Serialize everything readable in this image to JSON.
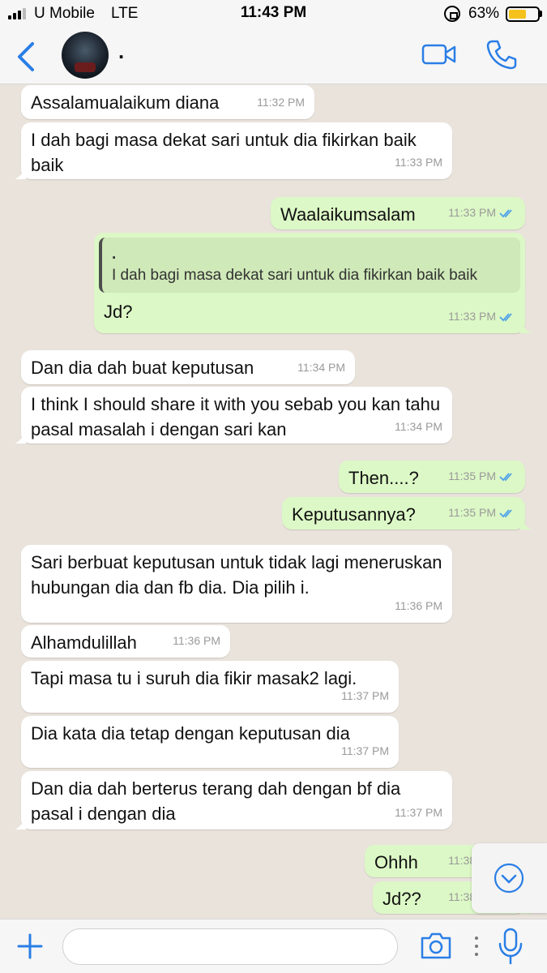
{
  "status_bar": {
    "carrier": "U Mobile",
    "network": "LTE",
    "time": "11:43 PM",
    "battery_percent": "63%",
    "battery_level": 0.63,
    "signal_bars": 3,
    "battery_color": "#f4c21b"
  },
  "header": {
    "contact_name": ".",
    "back_icon": "chevron-left-icon",
    "video_icon": "video-camera-icon",
    "call_icon": "phone-icon",
    "accent_color": "#2a7ee6"
  },
  "messages": [
    {
      "dir": "in",
      "text": "Assalamualaikum diana",
      "time": "11:32 PM"
    },
    {
      "dir": "in",
      "text": "I dah bagi masa dekat sari untuk dia fikirkan baik baik",
      "time": "11:33 PM"
    },
    {
      "dir": "out",
      "text": "Waalaikumsalam",
      "time": "11:33 PM",
      "read": true
    },
    {
      "dir": "out",
      "text": "Jd?",
      "time": "11:33 PM",
      "read": true,
      "quote": {
        "author": ".",
        "text": "I dah bagi masa dekat sari untuk dia fikirkan baik baik"
      }
    },
    {
      "dir": "in",
      "text": "Dan dia dah buat keputusan",
      "time": "11:34 PM"
    },
    {
      "dir": "in",
      "text": "I think I should share it with you sebab you kan tahu pasal masalah i dengan sari kan",
      "time": "11:34 PM"
    },
    {
      "dir": "out",
      "text": "Then....?",
      "time": "11:35 PM",
      "read": true
    },
    {
      "dir": "out",
      "text": "Keputusannya?",
      "time": "11:35 PM",
      "read": true
    },
    {
      "dir": "in",
      "text": "Sari berbuat keputusan untuk tidak lagi meneruskan hubungan dia dan fb dia. Dia pilih i.",
      "time": "11:36 PM"
    },
    {
      "dir": "in",
      "text": "Alhamdulillah",
      "time": "11:36 PM"
    },
    {
      "dir": "in",
      "text": "Tapi masa tu i suruh dia fikir masak2 lagi.",
      "time": "11:37 PM"
    },
    {
      "dir": "in",
      "text": "Dia kata dia tetap dengan keputusan dia",
      "time": "11:37 PM"
    },
    {
      "dir": "in",
      "text": "Dan dia dah berterus terang dah dengan bf dia pasal i dengan dia",
      "time": "11:37 PM"
    },
    {
      "dir": "out",
      "text": "Ohhh",
      "time": "11:38 PM",
      "read": true
    },
    {
      "dir": "out",
      "text": "Jd??",
      "time": "11:38 PM",
      "read": true
    }
  ],
  "colors": {
    "incoming_bubble": "#ffffff",
    "outgoing_bubble": "#dcf8c6",
    "read_tick": "#4fa3e8",
    "chat_background": "#e9e3dc"
  },
  "input_bar": {
    "placeholder": "",
    "icons": [
      "plus-icon",
      "camera-icon",
      "more-dots-icon",
      "microphone-icon"
    ]
  },
  "scroll_down_icon": "chevron-down-circle-icon"
}
